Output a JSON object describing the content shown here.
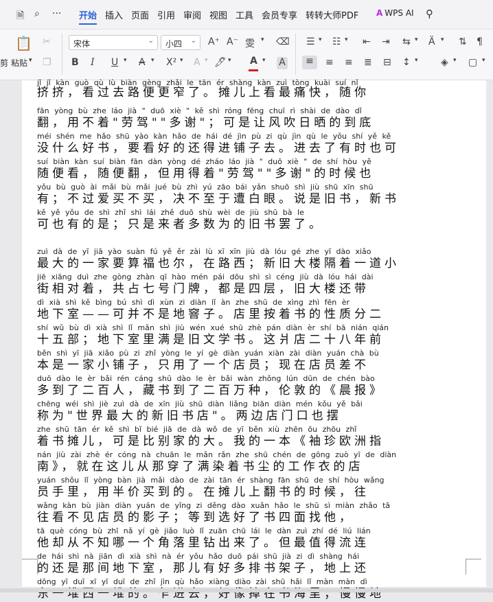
{
  "menubar": {
    "tabs": [
      "开始",
      "插入",
      "页面",
      "引用",
      "审阅",
      "视图",
      "工具",
      "会员专享",
      "转转大师PDF"
    ],
    "active_tab": "开始",
    "wps_ai_label": "WPS AI"
  },
  "ribbon": {
    "paste_label": "粘贴",
    "font_name": "宋体",
    "font_size": "小四",
    "bold": "B",
    "italic": "I",
    "underline": "U",
    "strike": "A",
    "superscript": "X²",
    "font_color": "A",
    "highlight": "A",
    "grow_font": "A⁺",
    "shrink_font": "A⁻",
    "colors": {
      "font_color_bar": "#d21f1f",
      "accent": "#2f64d6"
    }
  },
  "document": {
    "lines": [
      {
        "py": "jǐ jǐ  kàn guò qù lù biàn gèng zhǎi le   tān ér shàng kàn zuì tòng kuài   suí nǐ",
        "hz": "挤挤，看过去路便更窄了。摊儿上看最痛快，随你"
      },
      {
        "py": "fān   yòng bù zhe   láo jià  \" duō xiè \"   kě shì róng fēng chuī rì shài de dào dǐ",
        "hz": "翻，用不着\"劳驾\"\"多谢\"；可是让风吹日晒的到底"
      },
      {
        "py": "méi shén me hǎo shū   yào kàn hǎo de hái dé jìn pù zi qù   jìn qù le yǒu shí yě kě",
        "hz": "没什么好书，要看好的还得进铺子去。进去了有时也可"
      },
      {
        "py": "suí biàn kàn   suí biàn fān   dàn yòng dé zháo láo jià  \" duō xiè \" de shí hòu yě",
        "hz": "随便看，随便翻，但用得着\"劳驾\"\"多谢\"的时候也"
      },
      {
        "py": "yǒu  bù guò ài mǎi bù mǎi  jué bù zhì yú zāo bái yǎn   shuō shì jiù shū   xīn shū",
        "hz": "有；不过爱买不买，决不至于遭白眼。说是旧书，新书"
      },
      {
        "py": "kě yě yǒu de shì   zhǐ shì lái zhě duō shù wèi de jiù shū bà le",
        "hz": "可也有的是；只是来者多数为的旧书罢了。"
      },
      {
        "gap": true
      },
      {
        "py": "zuì dà de yī jiā yào suàn fú yě ěr  zài lù xī   xīn jiù dà lóu gé zhe yī dào xiǎo",
        "hz": "最大的一家要算福也尔，在路西；新旧大楼隔着一道小"
      },
      {
        "py": "jiē xiāng duì zhe   gòng zhàn qī hào mén pái  dōu shì sì céng   jiù dà lóu hái dài",
        "hz": "街相对着，共占七号门牌，都是四层，旧大楼还带"
      },
      {
        "py": "dì xià shì    kě bìng bú shì dì xùn zi   diàn lǐ àn zhe shū de xìng zhì fēn èr",
        "hz": "地下室——可并不是地窨子。店里按着书的性质分二"
      },
      {
        "py": "shí wǔ bù   dì xià shì lǐ mǎn shì jiù wén xué shū   zhè pán diàn èr shí bā nián qián",
        "hz": "十五部；地下室里满是旧文学书。这爿店二十八年前"
      },
      {
        "py": "běn shì yī jiā xiǎo pù zi   zhǐ yòng le yí gè diàn yuán   xiàn zài diàn yuán chà bù",
        "hz": "本是一家小铺子，只用了一个店员；现在店员差不"
      },
      {
        "py": "duō dào le èr bǎi rén   cáng shū dào le èr bǎi wàn zhǒng   lún dūn de  chén bào",
        "hz": "多到了二百人，藏书到了二百万种，伦敦的《晨报》"
      },
      {
        "py": "chēng wéi  shì jiè zuì dà de xīn jiù shū diàn    liǎng biān diàn mén kǒu yě bǎi",
        "hz": "称为\"世界最大的新旧书店\"。两边店门口也摆"
      },
      {
        "py": "zhe shū tān ér   kě shì bǐ bié jiā de dà   wǒ de yī běn   xiù zhēn ōu zhōu zhǐ",
        "hz": "着书摊儿，可是比别家的大。我的一本《袖珍欧洲指"
      },
      {
        "py": "nán    jiù zài zhè ér cóng nà chuān le mǎn rǎn zhe shū chén de gōng zuò yī de diàn",
        "hz": "南》，就在这儿从那穿了满染着书尘的工作衣的店"
      },
      {
        "py": "yuán shǒu lǐ   yòng bàn jià mǎi dào de   zài tān ér shàng fān shū de shí hòu   wǎng",
        "hz": "员手里，用半价买到的。在摊儿上翻书的时候，往"
      },
      {
        "py": "wǎng kàn bù jiàn diàn yuán de yǐng zi   děng dào xuǎn hǎo le shū sì miàn zhǎo tā",
        "hz": "往看不见店员的影子；等到选好了书四面找他，"
      },
      {
        "py": "tā què cóng bù zhī nǎ yí gè jiǎo luò lǐ zuān chū lái le   dàn zuì zhí dé liú lián",
        "hz": "他却从不知哪一个角落里钻出来了。但最值得流连"
      },
      {
        "py": "de hái shì nà jiān dì xià shì   nà ér yǒu hǎo duō pái shū jià zi   dì shàng hái",
        "hz": "的还是那间地下室，那儿有好多排书架子，地上还"
      },
      {
        "py": "dōng yī duī xī yī duī de   zhǐ jìn qù   hǎo xiàng diào zài shū hǎi lǐ   màn màn dì",
        "hz": "东一堆西一堆的。乍进去，好像掉在书海里；慢慢地"
      }
    ]
  }
}
